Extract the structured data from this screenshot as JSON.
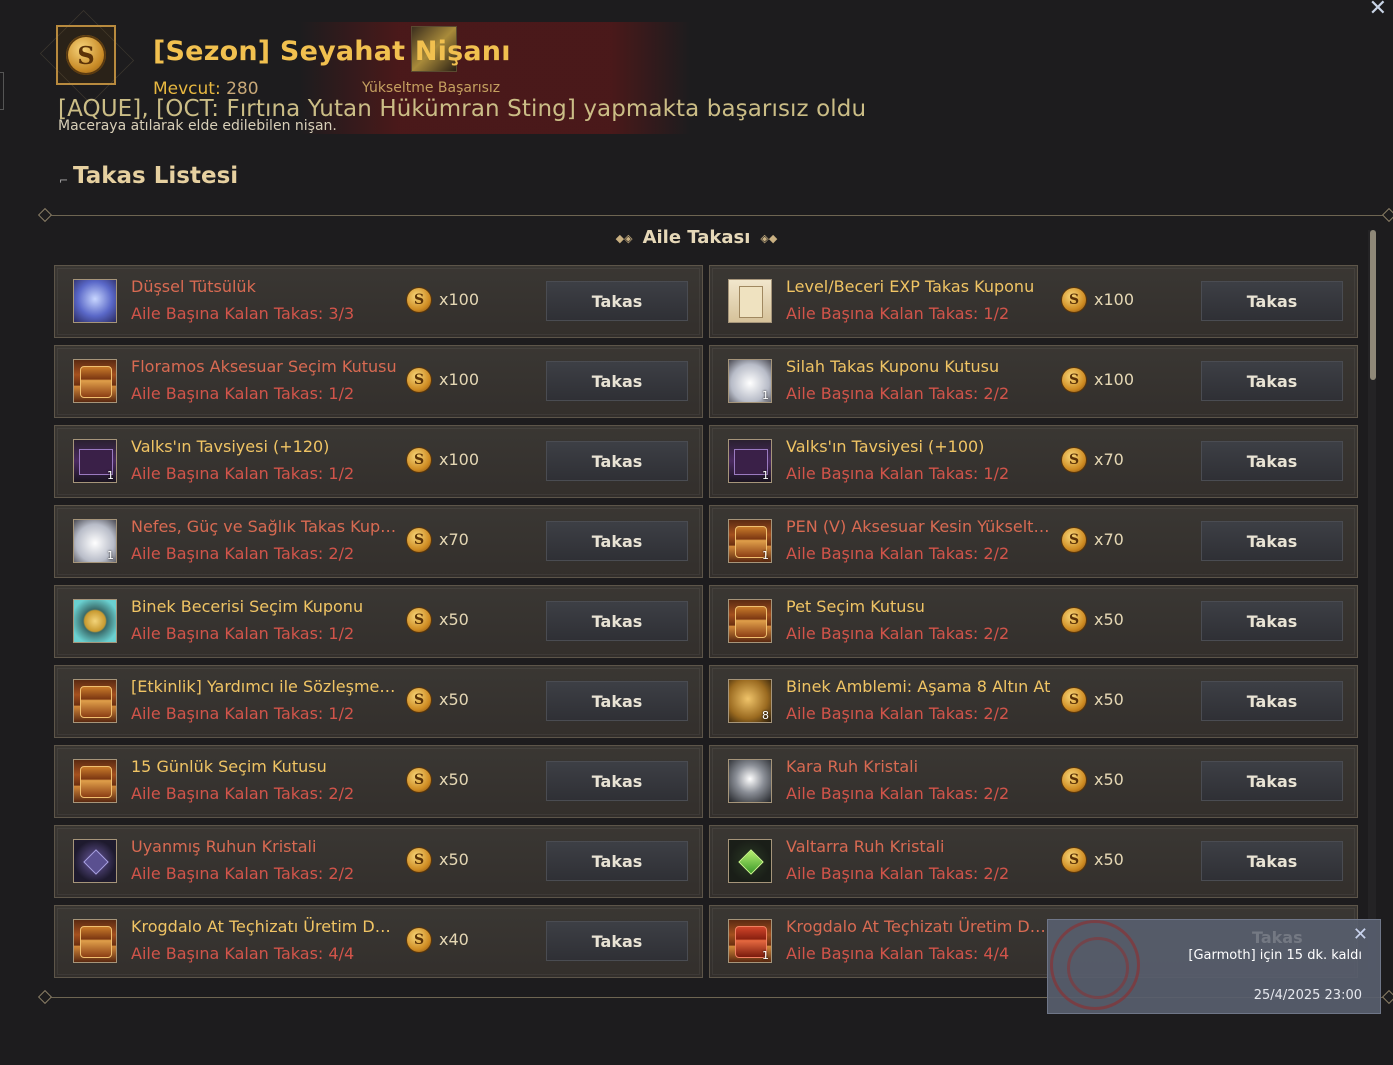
{
  "header": {
    "title": "[Sezon] Seyahat Nişanı",
    "current_label": "Mevcut:",
    "current_value": "280",
    "description": "Maceraya atılarak elde edilebilen nişan."
  },
  "notice": {
    "small": "Yükseltme Başarısız",
    "big": "[AQUE], [OCT: Fırtına Yutan Hükümran Sting] yapmakta başarısız oldu"
  },
  "section_title": "Takas Listesi",
  "subsection_title": "Aile Takası",
  "button_label": "Takas",
  "items": [
    {
      "name": "Düşsel Tütsülük",
      "remain": "Aile Başına Kalan Takas: 3/3",
      "price": "x100",
      "icon": "blue-dragon-icon",
      "qty": "",
      "name_color": "red"
    },
    {
      "name": "Level/Beceri EXP Takas Kuponu",
      "remain": "Aile Başına Kalan Takas: 1/2",
      "price": "x100",
      "icon": "scroll-icon",
      "qty": "",
      "name_color": "orange"
    },
    {
      "name": "Floramos Aksesuar Seçim Kutusu",
      "remain": "Aile Başına Kalan Takas: 1/2",
      "price": "x100",
      "icon": "chest-icon",
      "qty": "",
      "name_color": "red"
    },
    {
      "name": "Silah Takas Kuponu Kutusu",
      "remain": "Aile Başına Kalan Takas: 2/2",
      "price": "x100",
      "icon": "white-box-icon",
      "qty": "1",
      "name_color": "orange"
    },
    {
      "name": "Valks'ın Tavsiyesi (+120)",
      "remain": "Aile Başına Kalan Takas: 1/2",
      "price": "x100",
      "icon": "purple-scroll-icon",
      "qty": "1",
      "name_color": "orange"
    },
    {
      "name": "Valks'ın Tavsiyesi (+100)",
      "remain": "Aile Başına Kalan Takas: 1/2",
      "price": "x70",
      "icon": "purple-scroll-icon",
      "qty": "1",
      "name_color": "orange"
    },
    {
      "name": "Nefes, Güç ve Sağlık Takas Kuponu Kutusu",
      "remain": "Aile Başına Kalan Takas: 2/2",
      "price": "x70",
      "icon": "white-box-icon",
      "qty": "1",
      "name_color": "red"
    },
    {
      "name": "PEN (V) Aksesuar Kesin Yükseltme Kutusu",
      "remain": "Aile Başına Kalan Takas: 2/2",
      "price": "x70",
      "icon": "chest-icon",
      "qty": "1",
      "name_color": "red"
    },
    {
      "name": "Binek Becerisi Seçim Kuponu",
      "remain": "Aile Başına Kalan Takas: 1/2",
      "price": "x50",
      "icon": "compass-icon",
      "qty": "",
      "name_color": "orange"
    },
    {
      "name": "Pet Seçim Kutusu",
      "remain": "Aile Başına Kalan Takas: 2/2",
      "price": "x50",
      "icon": "chest-icon",
      "qty": "",
      "name_color": "orange"
    },
    {
      "name": "[Etkinlik] Yardımcı ile Sözleşme Kutusu",
      "remain": "Aile Başına Kalan Takas: 1/2",
      "price": "x50",
      "icon": "chest-icon",
      "qty": "",
      "name_color": "orange"
    },
    {
      "name": "Binek Amblemi: Aşama 8 Altın At",
      "remain": "Aile Başına Kalan Takas: 2/2",
      "price": "x50",
      "icon": "horse-icon",
      "qty": "8",
      "name_color": "orange"
    },
    {
      "name": "15 Günlük Seçim Kutusu",
      "remain": "Aile Başına Kalan Takas: 2/2",
      "price": "x50",
      "icon": "chest-icon",
      "qty": "",
      "name_color": "orange"
    },
    {
      "name": "Kara Ruh Kristali",
      "remain": "Aile Başına Kalan Takas: 2/2",
      "price": "x50",
      "icon": "crystal-icon",
      "qty": "",
      "name_color": "red"
    },
    {
      "name": "Uyanmış Ruhun Kristali",
      "remain": "Aile Başına Kalan Takas: 2/2",
      "price": "x50",
      "icon": "purple-gem-icon",
      "qty": "",
      "name_color": "red"
    },
    {
      "name": "Valtarra Ruh Kristali",
      "remain": "Aile Başına Kalan Takas: 2/2",
      "price": "x50",
      "icon": "green-gem-icon",
      "qty": "",
      "name_color": "red"
    },
    {
      "name": "Krogdalo At Teçhizatı Üretim Desteği Kutusu",
      "remain": "Aile Başına Kalan Takas: 4/4",
      "price": "x40",
      "icon": "chest-icon",
      "qty": "",
      "name_color": "orange"
    },
    {
      "name": "Krogdalo At Teçhizatı Üretim Desteği Kutusu",
      "remain": "Aile Başına Kalan Takas: 4/4",
      "price": "",
      "icon": "red-chest-icon",
      "qty": "1",
      "name_color": "red"
    }
  ],
  "toast": {
    "message": "[Garmoth] için 15 dk. kaldı",
    "time": "25/4/2025 23:00",
    "ghost": "Takas"
  }
}
